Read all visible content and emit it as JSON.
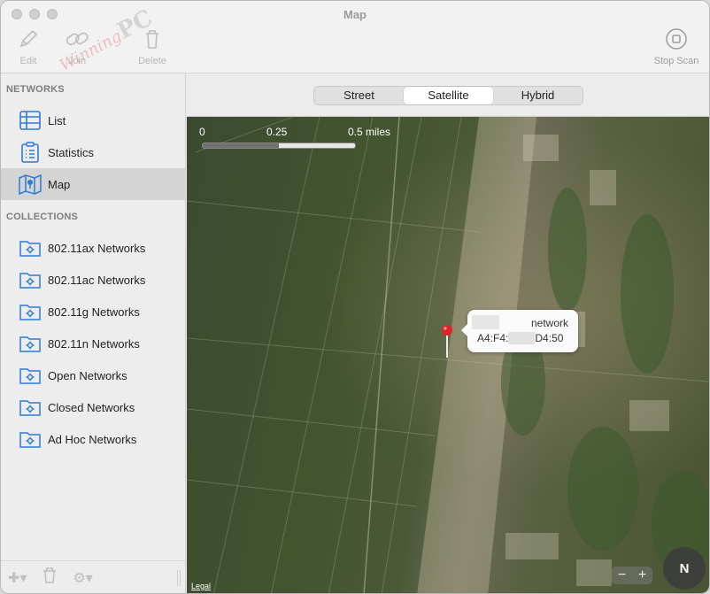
{
  "window": {
    "title": "Map"
  },
  "toolbar": {
    "edit_label": "Edit",
    "join_label": "Join",
    "delete_label": "Delete",
    "stop_scan_label": "Stop Scan"
  },
  "watermark": {
    "brand": "PC",
    "name": "Winning"
  },
  "sidebar": {
    "networks_header": "NETWORKS",
    "networks": [
      {
        "label": "List",
        "icon": "list-icon"
      },
      {
        "label": "Statistics",
        "icon": "clipboard-icon"
      },
      {
        "label": "Map",
        "icon": "map-icon",
        "selected": true
      }
    ],
    "collections_header": "COLLECTIONS",
    "collections": [
      {
        "label": "802.11ax Networks",
        "icon": "folder-gear-icon"
      },
      {
        "label": "802.11ac Networks",
        "icon": "folder-gear-icon"
      },
      {
        "label": "802.11g Networks",
        "icon": "folder-gear-icon"
      },
      {
        "label": "802.11n Networks",
        "icon": "folder-gear-icon"
      },
      {
        "label": "Open Networks",
        "icon": "folder-gear-icon"
      },
      {
        "label": "Closed Networks",
        "icon": "folder-gear-icon"
      },
      {
        "label": "Ad Hoc Networks",
        "icon": "folder-gear-icon"
      }
    ]
  },
  "map_type": {
    "options": [
      "Street",
      "Satellite",
      "Hybrid"
    ],
    "selected": "Satellite"
  },
  "map": {
    "scale_labels": [
      "0",
      "0.25",
      "0.5 miles"
    ],
    "scale_fill": 0.5,
    "callout": {
      "line1": "network",
      "line2_prefix": "A4:F4:",
      "line2_suffix": "D4:50"
    },
    "legal_label": "Legal",
    "compass_label": "N",
    "zoom_out": "−",
    "zoom_in": "+"
  },
  "colors": {
    "pin": "#e0242b",
    "selected_row": "#d4d4d4",
    "icon_blue": "#2f7ad8"
  }
}
